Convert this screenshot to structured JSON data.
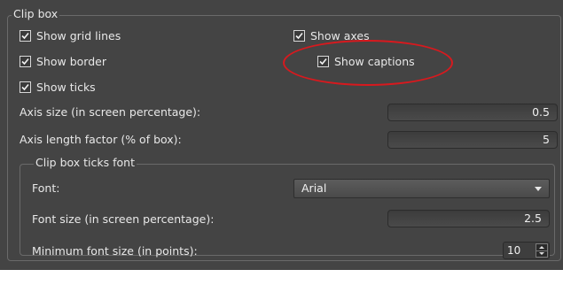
{
  "clip_box": {
    "title": "Clip box",
    "checkboxes": {
      "show_grid_lines": {
        "label": "Show grid lines",
        "checked": true
      },
      "show_axes": {
        "label": "Show axes",
        "checked": true
      },
      "show_border": {
        "label": "Show border",
        "checked": true
      },
      "show_captions": {
        "label": "Show captions",
        "checked": true
      },
      "show_ticks": {
        "label": "Show ticks",
        "checked": true
      }
    },
    "axis_size": {
      "label": "Axis size (in screen percentage):",
      "value": "0.5"
    },
    "axis_length_factor": {
      "label": "Axis length factor (% of box):",
      "value": "5"
    },
    "ticks_font": {
      "title": "Clip box ticks font",
      "font": {
        "label": "Font:",
        "value": "Arial"
      },
      "font_size": {
        "label": "Font size (in screen percentage):",
        "value": "2.5"
      },
      "min_font_size": {
        "label": "Minimum font size (in points):",
        "value": "10"
      }
    }
  },
  "annotation": {
    "color": "#d8191e"
  }
}
